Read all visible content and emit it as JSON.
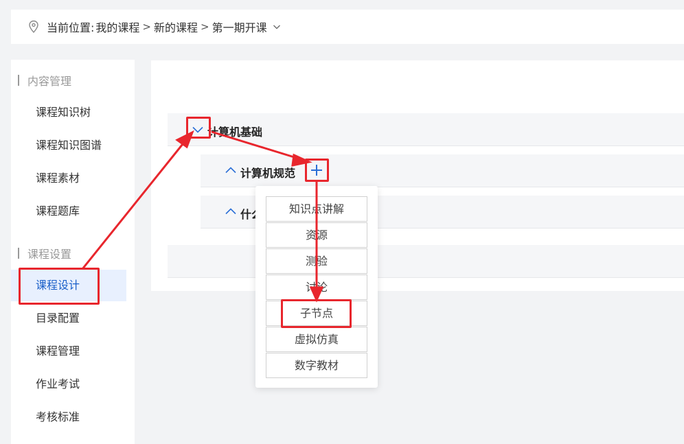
{
  "breadcrumb": {
    "prefix": "当前位置:",
    "items": [
      "我的课程",
      "新的课程",
      "第一期开课"
    ],
    "separator": ">"
  },
  "sidebar": {
    "sections": [
      {
        "title": "内容管理",
        "items": [
          "课程知识树",
          "课程知识图谱",
          "课程素材",
          "课程题库"
        ]
      },
      {
        "title": "课程设置",
        "items": [
          "课程设计",
          "目录配置",
          "课程管理",
          "作业考试",
          "考核标准"
        ]
      }
    ],
    "active": "课程设计"
  },
  "tree": {
    "root": {
      "label": "计算机基础"
    },
    "children": [
      {
        "label": "计算机规范"
      },
      {
        "label": "什么"
      }
    ],
    "add_icon": "plus-icon"
  },
  "popup_menu": {
    "items": [
      "知识点讲解",
      "资源",
      "测验",
      "讨论",
      "子节点",
      "虚拟仿真",
      "数字教材"
    ],
    "highlighted": "子节点"
  },
  "colors": {
    "accent": "#1a5fc8",
    "annotation_red": "#e8262d",
    "active_bg": "#e8f0fe"
  }
}
